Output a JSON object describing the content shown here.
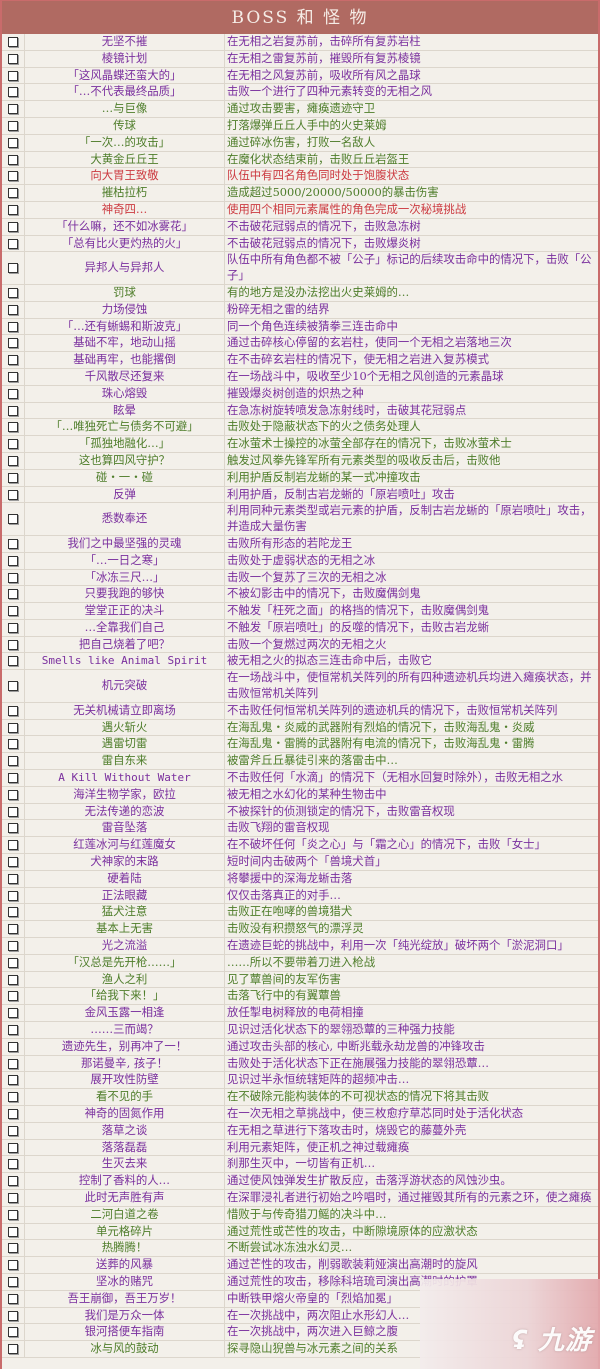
{
  "header": {
    "title": "BOSS 和 怪 物"
  },
  "colors": {
    "purple": "#7a2f9e",
    "green": "#4e7d2a",
    "red": "#cc3a40",
    "header_bg": "#b06a62"
  },
  "rows": [
    {
      "name": "无坚不摧",
      "desc": "在无相之岩复苏前，击碎所有复苏岩柱",
      "color": "purple"
    },
    {
      "name": "棱镜计划",
      "desc": "在无相之雷复苏前，摧毁所有复苏棱镜",
      "color": "purple"
    },
    {
      "name": "「这风晶蝶还蛮大的」",
      "desc": "在无相之风复苏前，吸收所有风之晶球",
      "color": "purple"
    },
    {
      "name": "「…不代表最终品质」",
      "desc": "击败一个进行了四种元素转变的无相之风",
      "color": "purple"
    },
    {
      "name": "…与巨像",
      "desc": "通过攻击要害，瘫痪遗迹守卫",
      "color": "green"
    },
    {
      "name": "传球",
      "desc": "打落爆弹丘丘人手中的火史莱姆",
      "color": "green"
    },
    {
      "name": "「一次…的攻击」",
      "desc": "通过碎冰伤害，打败一名敌人",
      "color": "green"
    },
    {
      "name": "大黄金丘丘王",
      "desc": "在魔化状态结束前，击败丘丘岩盔王",
      "color": "green"
    },
    {
      "name": "向大胃王致敬",
      "desc": "队伍中有四名角色同时处于饱腹状态",
      "color": "red"
    },
    {
      "name": "摧枯拉朽",
      "desc": "造成超过5000/20000/50000的暴击伤害",
      "color": "green"
    },
    {
      "name": "神奇四…",
      "desc": "使用四个相同元素属性的角色完成一次秘境挑战",
      "color": "red"
    },
    {
      "name": "「什么嘛，还不如冰雾花」",
      "desc": "不击破花冠弱点的情况下，击败急冻树",
      "color": "purple"
    },
    {
      "name": "「总有比火更灼热的火」",
      "desc": "不击破花冠弱点的情况下，击败爆炎树",
      "color": "purple"
    },
    {
      "name": "异邦人与异邦人",
      "desc": "队伍中所有角色都不被「公子」标记的后续攻击命中的情况下，击败「公子」",
      "color": "purple"
    },
    {
      "name": "罚球",
      "desc": "有的地方是没办法挖出火史莱姆的…",
      "color": "green"
    },
    {
      "name": "力场侵蚀",
      "desc": "粉碎无相之雷的结界",
      "color": "purple"
    },
    {
      "name": "「…还有蜥蜴和斯波克」",
      "desc": "同一个角色连续被猜拳三连击命中",
      "color": "purple"
    },
    {
      "name": "基础不牢，地动山摇",
      "desc": "通过击碎核心停留的玄岩柱，使同一个无相之岩落地三次",
      "color": "purple"
    },
    {
      "name": "基础再牢，也能撂倒",
      "desc": "在不击碎玄岩柱的情况下，使无相之岩进入复苏模式",
      "color": "purple"
    },
    {
      "name": "千风散尽还复来",
      "desc": "在一场战斗中，吸收至少10个无相之风创造的元素晶球",
      "color": "purple"
    },
    {
      "name": "珠心熔毁",
      "desc": "摧毁爆炎树创造的炽热之种",
      "color": "purple"
    },
    {
      "name": "眩晕",
      "desc": "在急冻树旋转喷发急冻射线时，击破其花冠弱点",
      "color": "purple"
    },
    {
      "name": "「…唯独死亡与债务不可避」",
      "desc": "击败处于隐蔽状态下的火之债务处理人",
      "color": "green"
    },
    {
      "name": "「孤独地融化…」",
      "desc": "在冰萤术士操控的冰萤全部存在的情况下，击败冰萤术士",
      "color": "green"
    },
    {
      "name": "这也算四风守护？",
      "desc": "触发过风拳先锋军所有元素类型的吸收反击后，击败他",
      "color": "green"
    },
    {
      "name": "碰・一・碰",
      "desc": "利用护盾反制岩龙蜥的某一式冲撞攻击",
      "color": "green"
    },
    {
      "name": "反弹",
      "desc": "利用护盾，反制古岩龙蜥的「原岩喷吐」攻击",
      "color": "purple"
    },
    {
      "name": "悉数奉还",
      "desc": "利用同种元素类型或岩元素的护盾，反制古岩龙蜥的「原岩喷吐」攻击，并造成大量伤害",
      "color": "purple"
    },
    {
      "name": "我们之中最坚强的灵魂",
      "desc": "击败所有形态的若陀龙王",
      "color": "purple"
    },
    {
      "name": "「…一日之寒」",
      "desc": "击败处于虚弱状态的无相之冰",
      "color": "purple"
    },
    {
      "name": "「冰冻三尺…」",
      "desc": "击败一个复苏了三次的无相之冰",
      "color": "purple"
    },
    {
      "name": "只要我跑的够快",
      "desc": "不被幻影击中的情况下，击败魔偶剑鬼",
      "color": "purple"
    },
    {
      "name": "堂堂正正的决斗",
      "desc": "不触发「枉死之面」的格挡的情况下，击败魔偶剑鬼",
      "color": "purple"
    },
    {
      "name": "…全靠我们自己",
      "desc": "不触发「原岩喷吐」的反噬的情况下，击败古岩龙蜥",
      "color": "purple"
    },
    {
      "name": "把自己烧着了吧？",
      "desc": "击败一个复燃过两次的无相之火",
      "color": "purple"
    },
    {
      "name": "Smells like Animal Spirit",
      "desc": "被无相之火的拟态三连击命中后，击败它",
      "color": "purple",
      "mono": true
    },
    {
      "name": "机元突破",
      "desc": "在一场战斗中，使恒常机关阵列的所有四种遗迹机兵均进入瘫痪状态，并击败恒常机关阵列",
      "color": "purple"
    },
    {
      "name": "无关机械请立即离场",
      "desc": "不击败任何恒常机关阵列的遗迹机兵的情况下，击败恒常机关阵列",
      "color": "purple"
    },
    {
      "name": "遇火斩火",
      "desc": "在海乱鬼・炎威的武器附有烈焰的情况下，击败海乱鬼・炎威",
      "color": "green"
    },
    {
      "name": "遇雷切雷",
      "desc": "在海乱鬼・雷腾的武器附有电流的情况下，击败海乱鬼・雷腾",
      "color": "green"
    },
    {
      "name": "雷自东来",
      "desc": "被雷斧丘丘暴徒引来的落雷击中…",
      "color": "green"
    },
    {
      "name": "A Kill Without Water",
      "desc": "不击败任何「水滴」的情况下（无相水回复时除外），击败无相之水",
      "color": "purple",
      "mono": true
    },
    {
      "name": "海洋生物学家，欧拉",
      "desc": "被无相之水幻化的某种生物击中",
      "color": "purple"
    },
    {
      "name": "无法传递的恋波",
      "desc": "不被探针的侦测锁定的情况下，击败雷音权现",
      "color": "purple"
    },
    {
      "name": "雷音坠落",
      "desc": "击败飞翔的雷音权现",
      "color": "purple"
    },
    {
      "name": "红莲冰河与红莲魔女",
      "desc": "在不破坏任何「炎之心」与「霜之心」的情况下，击败「女士」",
      "color": "purple"
    },
    {
      "name": "犬神家的末路",
      "desc": "短时间内击破两个「兽境犬首」",
      "color": "purple"
    },
    {
      "name": "硬着陆",
      "desc": "将攀援中的深海龙蜥击落",
      "color": "purple"
    },
    {
      "name": "正法眼藏",
      "desc": "仅仅击落真正的对手…",
      "color": "purple"
    },
    {
      "name": "猛犬注意",
      "desc": "击败正在咆哮的兽境猎犬",
      "color": "green"
    },
    {
      "name": "基本上无害",
      "desc": "击败没有积攒怒气的漂浮灵",
      "color": "green"
    },
    {
      "name": "光之流溢",
      "desc": "在遗迹巨蛇的挑战中，利用一次「纯光绽放」破坏两个「淤泥洞口」",
      "color": "purple"
    },
    {
      "name": "「汉总是先开枪……」",
      "desc": "……所以不要带着刀进入枪战",
      "color": "green"
    },
    {
      "name": "渔人之利",
      "desc": "见了蕈兽间的友军伤害",
      "color": "green"
    },
    {
      "name": "「给我下来！」",
      "desc": "击落飞行中的有翼蕈兽",
      "color": "green"
    },
    {
      "name": "金风玉露一相逢",
      "desc": "放任掣电树释放的电荷相撞",
      "color": "purple"
    },
    {
      "name": "……三而竭？",
      "desc": "见识过活化状态下的翠翎恐蕈的三种强力技能",
      "color": "purple"
    },
    {
      "name": "遗迹先生，别再冲了一！",
      "desc": "通过攻击头部的核心, 中断兆载永劫龙兽的冲锋攻击",
      "color": "purple"
    },
    {
      "name": "那诺曼辛, 孩子！",
      "desc": "击败处于活化状态下正在施展强力技能的翠翎恐蕈…",
      "color": "purple"
    },
    {
      "name": "展开攻性防壁",
      "desc": "见识过半永恒统辖矩阵的超频冲击…",
      "color": "purple"
    },
    {
      "name": "看不见的手",
      "desc": "在不破除元能构装体的不可视状态的情况下将其击败",
      "color": "green"
    },
    {
      "name": "神奇的固氮作用",
      "desc": "在一次无相之草挑战中，使三枚愈疗草芯同时处于活化状态",
      "color": "purple"
    },
    {
      "name": "落草之谈",
      "desc": "在无相之草进行下落攻击时，烧毁它的藤蔓外壳",
      "color": "purple"
    },
    {
      "name": "落落磊磊",
      "desc": "利用元素矩阵，使正机之神过载瘫痪",
      "color": "purple"
    },
    {
      "name": "生灭去来",
      "desc": "刹那生灭中，一切皆有正机…",
      "color": "purple"
    },
    {
      "name": "控制了香料的人…",
      "desc": "通过使风蚀弹发生扩散反应，击落浮游状态的风蚀沙虫。",
      "color": "purple"
    },
    {
      "name": "此时无声胜有声",
      "desc": "在深罪浸礼者进行初始之吟唱时，通过摧毁其所有的元素之环，使之瘫痪",
      "color": "purple"
    },
    {
      "name": "二河白道之卷",
      "desc": "惜败于与传奇猎刀鳐的决斗中…",
      "color": "green"
    },
    {
      "name": "单元格碎片",
      "desc": "通过荒性或芒性的攻击，中断隙境原体的应激状态",
      "color": "green"
    },
    {
      "name": "热腾腾！",
      "desc": "不断尝试冰冻浊水幻灵…",
      "color": "green"
    },
    {
      "name": "送葬的风暴",
      "desc": "通过芒性的攻击，削弱歌装莉娅演出高潮时的旋风",
      "color": "purple"
    },
    {
      "name": "坚冰的赌咒",
      "desc": "通过荒性的攻击，移除科培琉司演出高潮时的护罩",
      "color": "purple"
    },
    {
      "name": "吾王崩御，吾王万岁！",
      "desc": "中断铁甲熔火帝皇的「烈焰加冕」",
      "color": "purple"
    },
    {
      "name": "我们是万众一体",
      "desc": "在一次挑战中，两次阻止水形幻人…",
      "color": "purple"
    },
    {
      "name": "银河搭便车指南",
      "desc": "在一次挑战中，两次进入巨鲸之腹",
      "color": "purple"
    },
    {
      "name": "冰与风的鼓动",
      "desc": "探寻隐山猊兽与冰元素之间的关系",
      "color": "green"
    }
  ],
  "watermark": {
    "text": "九游"
  }
}
